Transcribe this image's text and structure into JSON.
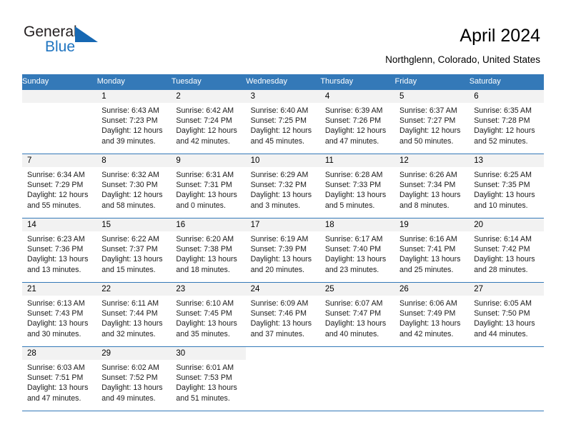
{
  "brand": {
    "name_part1": "General",
    "name_part2": "Blue",
    "triangle_color": "#1668b3",
    "blue_text_color": "#1f74c0"
  },
  "header": {
    "title": "April 2024",
    "subtitle": "Northglenn, Colorado, United States"
  },
  "theme": {
    "header_row_bg": "#3479b8",
    "header_row_text": "#ffffff",
    "daynum_band_bg": "#f2f2f2",
    "grid_line": "#3479b8",
    "body_text": "#1a1a1a"
  },
  "calendar": {
    "weekday_headers": [
      "Sunday",
      "Monday",
      "Tuesday",
      "Wednesday",
      "Thursday",
      "Friday",
      "Saturday"
    ],
    "weeks": [
      [
        {
          "day": "",
          "lines": []
        },
        {
          "day": "1",
          "lines": [
            "Sunrise: 6:43 AM",
            "Sunset: 7:23 PM",
            "Daylight: 12 hours",
            "and 39 minutes."
          ]
        },
        {
          "day": "2",
          "lines": [
            "Sunrise: 6:42 AM",
            "Sunset: 7:24 PM",
            "Daylight: 12 hours",
            "and 42 minutes."
          ]
        },
        {
          "day": "3",
          "lines": [
            "Sunrise: 6:40 AM",
            "Sunset: 7:25 PM",
            "Daylight: 12 hours",
            "and 45 minutes."
          ]
        },
        {
          "day": "4",
          "lines": [
            "Sunrise: 6:39 AM",
            "Sunset: 7:26 PM",
            "Daylight: 12 hours",
            "and 47 minutes."
          ]
        },
        {
          "day": "5",
          "lines": [
            "Sunrise: 6:37 AM",
            "Sunset: 7:27 PM",
            "Daylight: 12 hours",
            "and 50 minutes."
          ]
        },
        {
          "day": "6",
          "lines": [
            "Sunrise: 6:35 AM",
            "Sunset: 7:28 PM",
            "Daylight: 12 hours",
            "and 52 minutes."
          ]
        }
      ],
      [
        {
          "day": "7",
          "lines": [
            "Sunrise: 6:34 AM",
            "Sunset: 7:29 PM",
            "Daylight: 12 hours",
            "and 55 minutes."
          ]
        },
        {
          "day": "8",
          "lines": [
            "Sunrise: 6:32 AM",
            "Sunset: 7:30 PM",
            "Daylight: 12 hours",
            "and 58 minutes."
          ]
        },
        {
          "day": "9",
          "lines": [
            "Sunrise: 6:31 AM",
            "Sunset: 7:31 PM",
            "Daylight: 13 hours",
            "and 0 minutes."
          ]
        },
        {
          "day": "10",
          "lines": [
            "Sunrise: 6:29 AM",
            "Sunset: 7:32 PM",
            "Daylight: 13 hours",
            "and 3 minutes."
          ]
        },
        {
          "day": "11",
          "lines": [
            "Sunrise: 6:28 AM",
            "Sunset: 7:33 PM",
            "Daylight: 13 hours",
            "and 5 minutes."
          ]
        },
        {
          "day": "12",
          "lines": [
            "Sunrise: 6:26 AM",
            "Sunset: 7:34 PM",
            "Daylight: 13 hours",
            "and 8 minutes."
          ]
        },
        {
          "day": "13",
          "lines": [
            "Sunrise: 6:25 AM",
            "Sunset: 7:35 PM",
            "Daylight: 13 hours",
            "and 10 minutes."
          ]
        }
      ],
      [
        {
          "day": "14",
          "lines": [
            "Sunrise: 6:23 AM",
            "Sunset: 7:36 PM",
            "Daylight: 13 hours",
            "and 13 minutes."
          ]
        },
        {
          "day": "15",
          "lines": [
            "Sunrise: 6:22 AM",
            "Sunset: 7:37 PM",
            "Daylight: 13 hours",
            "and 15 minutes."
          ]
        },
        {
          "day": "16",
          "lines": [
            "Sunrise: 6:20 AM",
            "Sunset: 7:38 PM",
            "Daylight: 13 hours",
            "and 18 minutes."
          ]
        },
        {
          "day": "17",
          "lines": [
            "Sunrise: 6:19 AM",
            "Sunset: 7:39 PM",
            "Daylight: 13 hours",
            "and 20 minutes."
          ]
        },
        {
          "day": "18",
          "lines": [
            "Sunrise: 6:17 AM",
            "Sunset: 7:40 PM",
            "Daylight: 13 hours",
            "and 23 minutes."
          ]
        },
        {
          "day": "19",
          "lines": [
            "Sunrise: 6:16 AM",
            "Sunset: 7:41 PM",
            "Daylight: 13 hours",
            "and 25 minutes."
          ]
        },
        {
          "day": "20",
          "lines": [
            "Sunrise: 6:14 AM",
            "Sunset: 7:42 PM",
            "Daylight: 13 hours",
            "and 28 minutes."
          ]
        }
      ],
      [
        {
          "day": "21",
          "lines": [
            "Sunrise: 6:13 AM",
            "Sunset: 7:43 PM",
            "Daylight: 13 hours",
            "and 30 minutes."
          ]
        },
        {
          "day": "22",
          "lines": [
            "Sunrise: 6:11 AM",
            "Sunset: 7:44 PM",
            "Daylight: 13 hours",
            "and 32 minutes."
          ]
        },
        {
          "day": "23",
          "lines": [
            "Sunrise: 6:10 AM",
            "Sunset: 7:45 PM",
            "Daylight: 13 hours",
            "and 35 minutes."
          ]
        },
        {
          "day": "24",
          "lines": [
            "Sunrise: 6:09 AM",
            "Sunset: 7:46 PM",
            "Daylight: 13 hours",
            "and 37 minutes."
          ]
        },
        {
          "day": "25",
          "lines": [
            "Sunrise: 6:07 AM",
            "Sunset: 7:47 PM",
            "Daylight: 13 hours",
            "and 40 minutes."
          ]
        },
        {
          "day": "26",
          "lines": [
            "Sunrise: 6:06 AM",
            "Sunset: 7:49 PM",
            "Daylight: 13 hours",
            "and 42 minutes."
          ]
        },
        {
          "day": "27",
          "lines": [
            "Sunrise: 6:05 AM",
            "Sunset: 7:50 PM",
            "Daylight: 13 hours",
            "and 44 minutes."
          ]
        }
      ],
      [
        {
          "day": "28",
          "lines": [
            "Sunrise: 6:03 AM",
            "Sunset: 7:51 PM",
            "Daylight: 13 hours",
            "and 47 minutes."
          ]
        },
        {
          "day": "29",
          "lines": [
            "Sunrise: 6:02 AM",
            "Sunset: 7:52 PM",
            "Daylight: 13 hours",
            "and 49 minutes."
          ]
        },
        {
          "day": "30",
          "lines": [
            "Sunrise: 6:01 AM",
            "Sunset: 7:53 PM",
            "Daylight: 13 hours",
            "and 51 minutes."
          ]
        },
        {
          "day": "",
          "lines": []
        },
        {
          "day": "",
          "lines": []
        },
        {
          "day": "",
          "lines": []
        },
        {
          "day": "",
          "lines": []
        }
      ]
    ]
  }
}
